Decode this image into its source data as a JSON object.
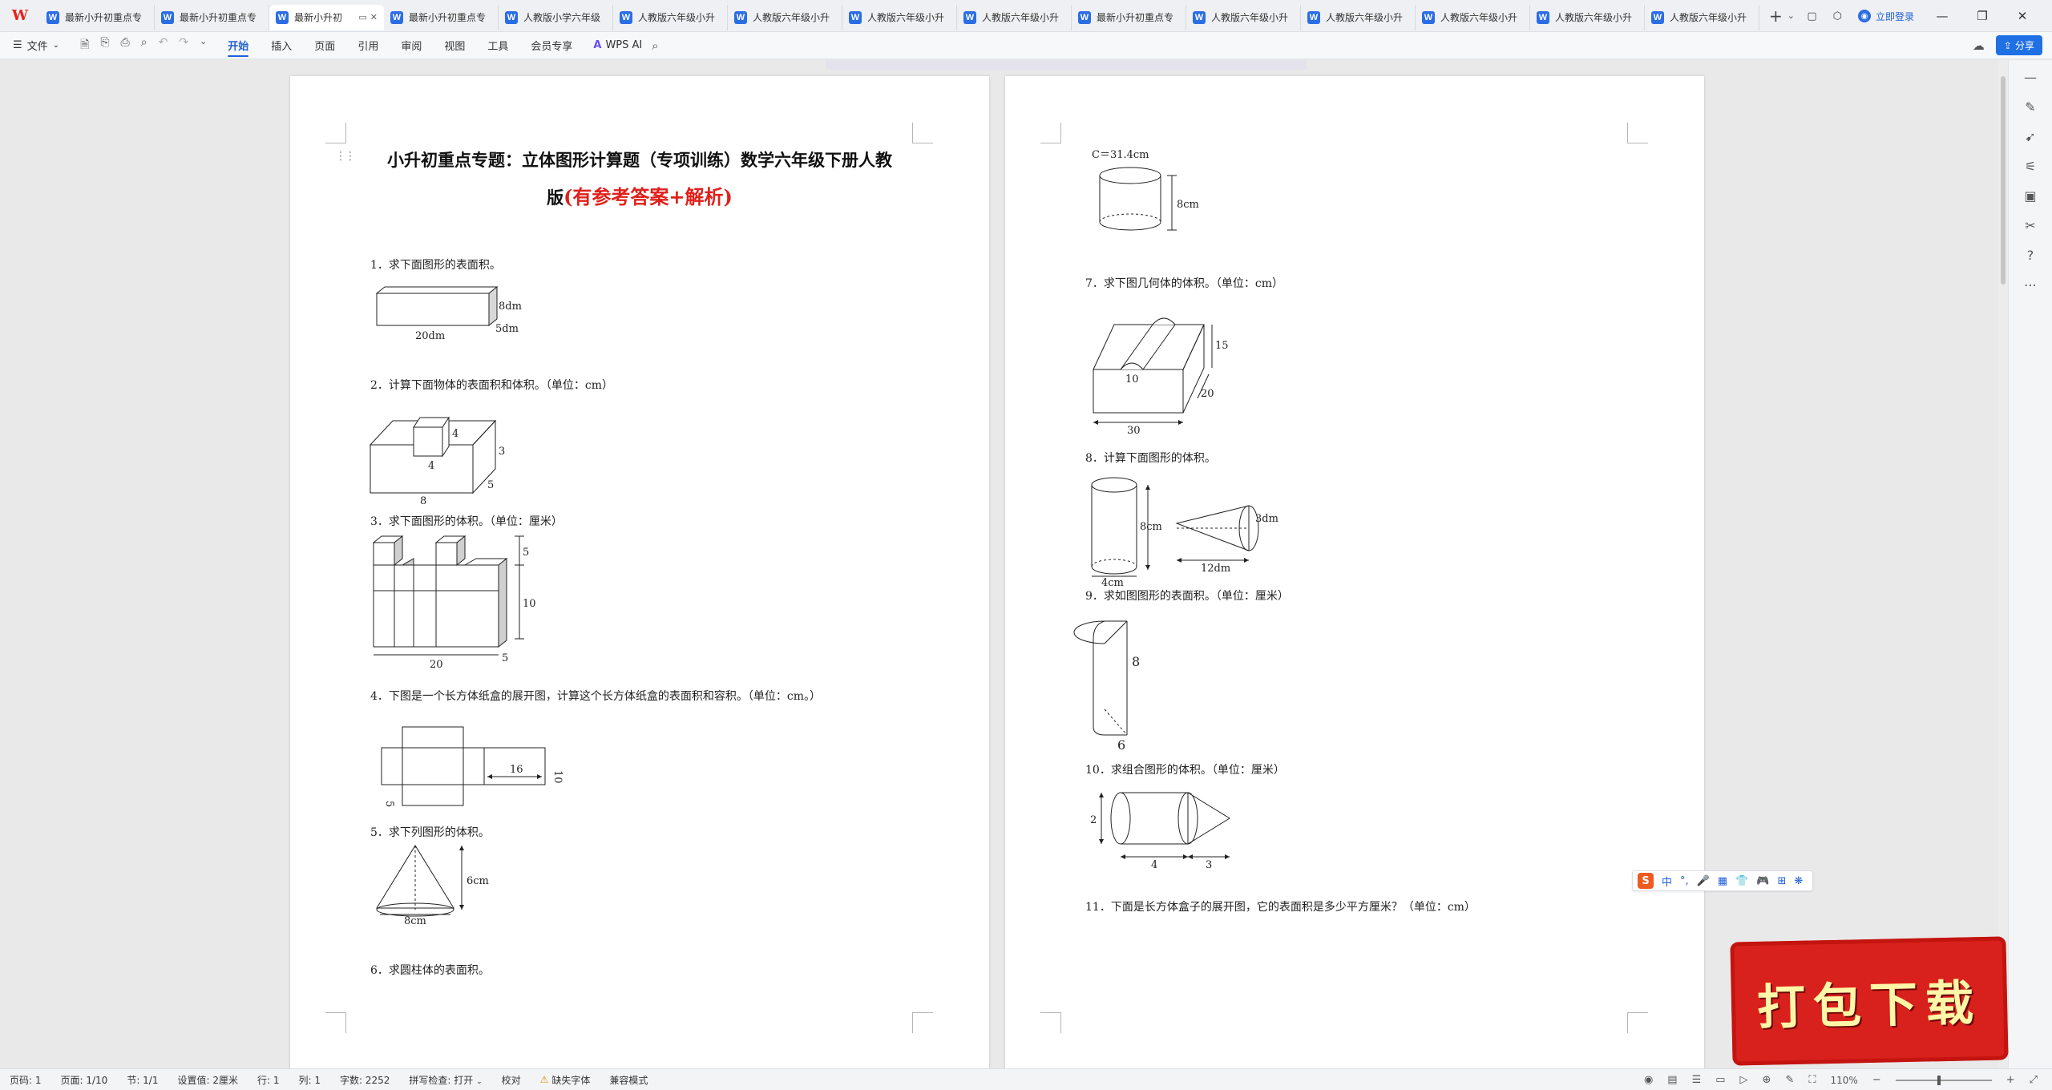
{
  "app": {
    "logo": "W"
  },
  "tabs": [
    {
      "label": "最新小升初重点专"
    },
    {
      "label": "最新小升初重点专"
    },
    {
      "label": "最新小升初",
      "active": true
    },
    {
      "label": "最新小升初重点专"
    },
    {
      "label": "人教版小学六年级"
    },
    {
      "label": "人教版六年级小升"
    },
    {
      "label": "人教版六年级小升"
    },
    {
      "label": "人教版六年级小升"
    },
    {
      "label": "人教版六年级小升"
    },
    {
      "label": "最新小升初重点专"
    },
    {
      "label": "人教版六年级小升"
    },
    {
      "label": "人教版六年级小升"
    },
    {
      "label": "人教版六年级小升"
    },
    {
      "label": "人教版六年级小升"
    },
    {
      "label": "人教版六年级小升"
    }
  ],
  "tab_icon_letter": "W",
  "titlebar": {
    "login_label": "立即登录",
    "new_tab_label": "+"
  },
  "ribbon": {
    "file_label": "文件",
    "tabs": [
      "开始",
      "插入",
      "页面",
      "引用",
      "审阅",
      "视图",
      "工具",
      "会员专享"
    ],
    "active_tab": "开始",
    "wps_ai_label": "WPS AI",
    "share_label": "分享"
  },
  "page1": {
    "title_line1": "小升初重点专题：立体图形计算题（专项训练）数学六年级下册人教",
    "title_line2_black": "版",
    "title_line2_red": "(有参考答案+解析)",
    "questions": {
      "q1": "1．求下面图形的表面积。",
      "q2": "2．计算下面物体的表面积和体积。（单位：cm）",
      "q3": "3．求下面图形的体积。（单位：厘米）",
      "q4": "4．下图是一个长方体纸盒的展开图，计算这个长方体纸盒的表面积和容积。（单位：cm。）",
      "q5": "5．求下列图形的体积。",
      "q6": "6．求圆柱体的表面积。"
    },
    "labels": {
      "q1_len": "20dm",
      "q1_h": "8dm",
      "q1_w": "5dm",
      "q2_cube": "4",
      "q2_cube_side": "4",
      "q2_h": "3",
      "q2_w": "5",
      "q2_len": "8",
      "q3_top": "5",
      "q3_mid": "10",
      "q3_len": "20",
      "q3_depth": "5",
      "q4_len": "16",
      "q4_w": "10",
      "q4_h": "5",
      "q5_h": "6cm",
      "q5_d": "8cm"
    }
  },
  "page2": {
    "questions": {
      "q7": "7．求下图几何体的体积。（单位：cm）",
      "q8": "8．计算下面图形的体积。",
      "q9": "9．求如图图形的表面积。（单位：厘米）",
      "q10": "10．求组合图形的体积。（单位：厘米）",
      "q11": "11．下面是长方体盒子的展开图，它的表面积是多少平方厘米？（单位：cm）"
    },
    "labels": {
      "q6_c": "C＝31.4cm",
      "q6_h": "8cm",
      "q7_h": "15",
      "q7_d": "10",
      "q7_w": "20",
      "q7_len": "30",
      "q8_cyl_h": "8cm",
      "q8_cyl_d": "4cm",
      "q8_cone_d": "3dm",
      "q8_cone_len": "12dm",
      "q9_h": "8",
      "q9_r": "6",
      "q10_d": "2",
      "q10_cyl_len": "4",
      "q10_cone_len": "3"
    }
  },
  "ime": {
    "logo": "S",
    "mode": "中",
    "items": [
      "°,",
      "🎤",
      "▦",
      "👕",
      "🎮",
      "⊞",
      "❋"
    ]
  },
  "promo": {
    "text": "打包下载"
  },
  "statusbar": {
    "page": "页码: 1",
    "page_of": "页面: 1/10",
    "section": "节: 1/1",
    "setting": "设置值: 2厘米",
    "row": "行: 1",
    "col": "列: 1",
    "words": "字数: 2252",
    "spell": "拼写检查: 打开",
    "proof": "校对",
    "missing_font": "缺失字体",
    "compat": "兼容模式",
    "zoom": "110%"
  },
  "colors": {
    "accent": "#1f5fd6",
    "title_red": "#e0201b",
    "promo_red": "#d8211c"
  }
}
